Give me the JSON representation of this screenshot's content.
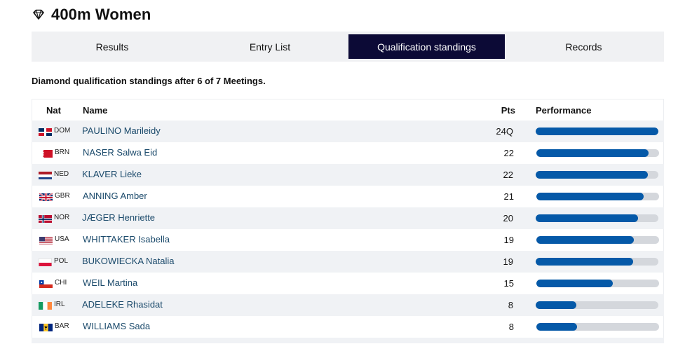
{
  "event": {
    "title": "400m Women"
  },
  "tabs": [
    {
      "label": "Results",
      "active": false
    },
    {
      "label": "Entry List",
      "active": false
    },
    {
      "label": "Qualification standings",
      "active": true
    },
    {
      "label": "Records",
      "active": false
    }
  ],
  "standings_note": "Diamond qualification standings after 6 of 7 Meetings.",
  "table": {
    "headers": {
      "nat": "Nat",
      "name": "Name",
      "pts": "Pts",
      "performance": "Performance"
    },
    "max_points": 24,
    "rows": [
      {
        "nat": "DOM",
        "flag": "flag-dom-icon",
        "name": "PAULINO Marileidy",
        "pts": "24Q",
        "points": 24
      },
      {
        "nat": "BRN",
        "flag": "flag-brn-icon",
        "name": "NASER Salwa Eid",
        "pts": "22",
        "points": 22
      },
      {
        "nat": "NED",
        "flag": "flag-ned-icon",
        "name": "KLAVER Lieke",
        "pts": "22",
        "points": 22
      },
      {
        "nat": "GBR",
        "flag": "flag-gbr-icon",
        "name": "ANNING Amber",
        "pts": "21",
        "points": 21
      },
      {
        "nat": "NOR",
        "flag": "flag-nor-icon",
        "name": "JÆGER Henriette",
        "pts": "20",
        "points": 20
      },
      {
        "nat": "USA",
        "flag": "flag-usa-icon",
        "name": "WHITTAKER Isabella",
        "pts": "19",
        "points": 19
      },
      {
        "nat": "POL",
        "flag": "flag-pol-icon",
        "name": "BUKOWIECKA Natalia",
        "pts": "19",
        "points": 19
      },
      {
        "nat": "CHI",
        "flag": "flag-chi-icon",
        "name": "WEIL Martina",
        "pts": "15",
        "points": 15
      },
      {
        "nat": "IRL",
        "flag": "flag-irl-icon",
        "name": "ADELEKE Rhasidat",
        "pts": "8",
        "points": 8
      },
      {
        "nat": "BAR",
        "flag": "flag-bar-icon",
        "name": "WILLIAMS Sada",
        "pts": "8",
        "points": 8
      }
    ]
  },
  "colors": {
    "active_tab": "#0c0a36",
    "tab_bar": "#f0f1f3",
    "bar_fill": "#0559a8",
    "bar_track": "#d4d7dc",
    "row_stripe": "#f0f2f5",
    "athlete_link": "#1b4a6b"
  }
}
